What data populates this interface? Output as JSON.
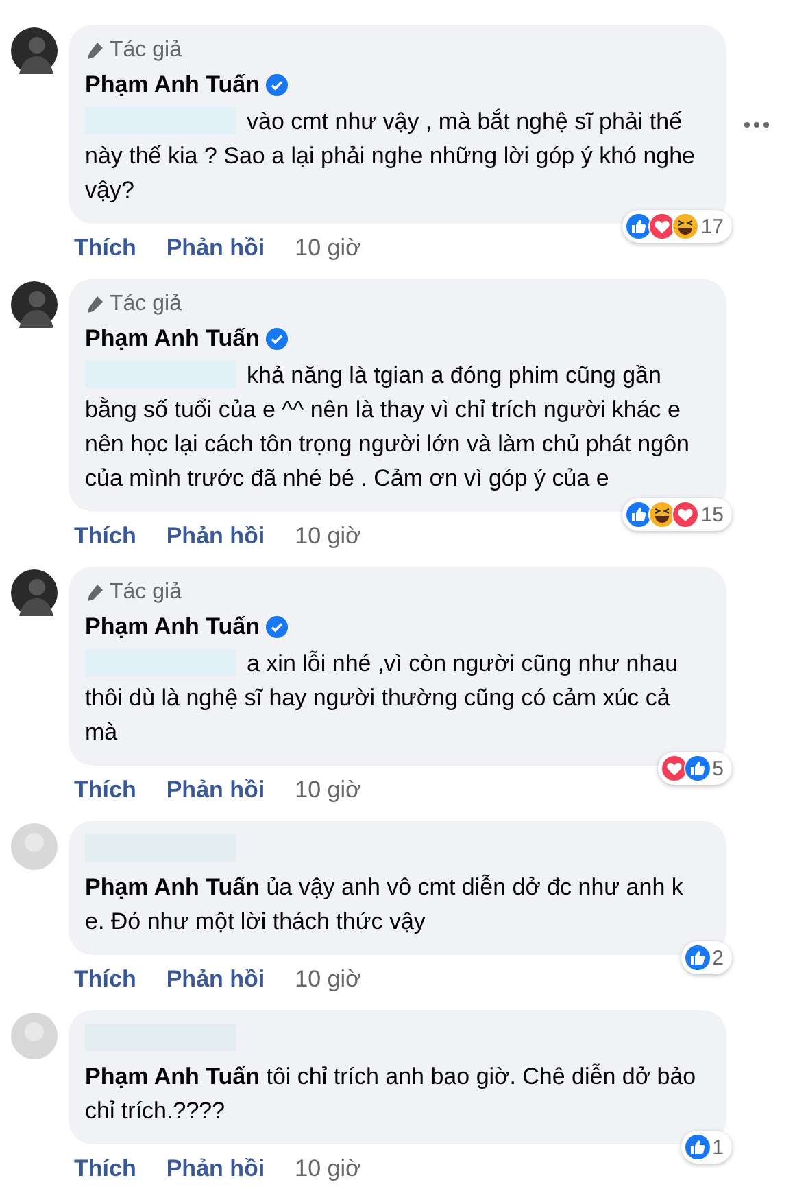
{
  "comments": [
    {
      "kind": "author",
      "badge": "Tác giả",
      "name": "Phạm Anh Tuấn",
      "text": "vào cmt như vậy , mà bắt nghệ sĩ phải thế này thế kia ? Sao a lại phải nghe những lời góp ý khó nghe vậy?",
      "more": true,
      "reactions": [
        {
          "kind": "like"
        },
        {
          "kind": "love"
        },
        {
          "kind": "haha"
        }
      ],
      "count": "17",
      "actions": [
        "Thích",
        "Phản hồi"
      ],
      "time": "10 giờ"
    },
    {
      "kind": "author",
      "badge": "Tác giả",
      "name": "Phạm Anh Tuấn",
      "text": "khả năng là tgian a đóng phim cũng gần bằng số tuổi của e ^^ nên là thay vì chỉ trích người khác e nên học lại cách tôn trọng người lớn và làm chủ phát ngôn của mình trước đã nhé bé . Cảm ơn vì góp ý của e",
      "reactions": [
        {
          "kind": "like"
        },
        {
          "kind": "haha"
        },
        {
          "kind": "love"
        }
      ],
      "count": "15",
      "actions": [
        "Thích",
        "Phản hồi"
      ],
      "time": "10 giờ"
    },
    {
      "kind": "author",
      "badge": "Tác giả",
      "name": "Phạm Anh Tuấn",
      "text": "a xin lỗi nhé ,vì còn người cũng như nhau thôi dù là nghệ sĩ hay người thường cũng có cảm xúc cả mà",
      "reactions": [
        {
          "kind": "love"
        },
        {
          "kind": "like"
        }
      ],
      "count": "5",
      "actions": [
        "Thích",
        "Phản hồi"
      ],
      "time": "10 giờ"
    },
    {
      "kind": "user",
      "text": "**Phạm Anh Tuấn** ủa vậy anh vô cmt diễn dở đc như anh k e. Đó như một lời thách thức vậy",
      "reactions": [
        {
          "kind": "like"
        }
      ],
      "count": "2",
      "actions": [
        "Thích",
        "Phản hồi"
      ],
      "time": "10 giờ"
    },
    {
      "kind": "user",
      "text": "**Phạm Anh Tuấn** tôi chỉ trích anh bao giờ. Chê diễn dở bảo chỉ trích.????",
      "reactions": [
        {
          "kind": "like"
        }
      ],
      "count": "1",
      "actions": [
        "Thích",
        "Phản hồi"
      ],
      "time": "10 giờ"
    }
  ]
}
